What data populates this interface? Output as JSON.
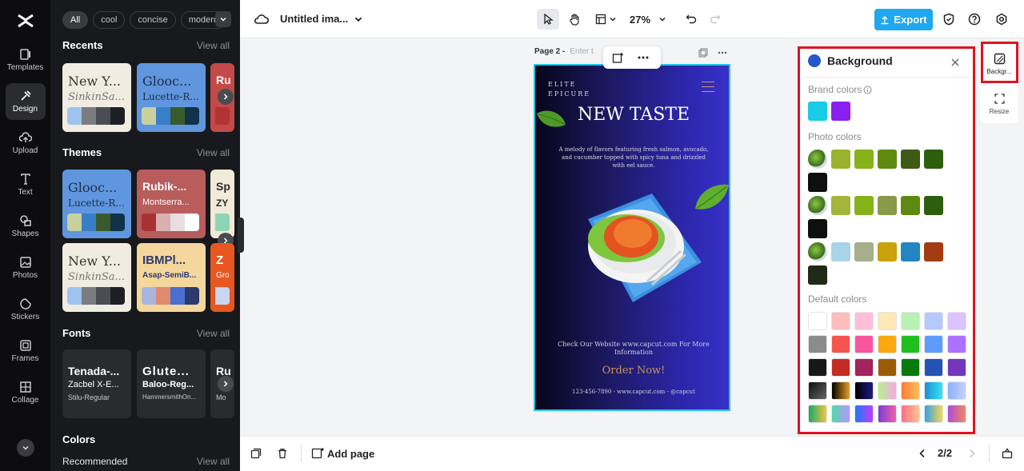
{
  "rail": {
    "items": [
      {
        "label": "Templates",
        "icon": "templates-icon"
      },
      {
        "label": "Design",
        "icon": "design-icon"
      },
      {
        "label": "Upload",
        "icon": "upload-icon"
      },
      {
        "label": "Text",
        "icon": "text-icon"
      },
      {
        "label": "Shapes",
        "icon": "shapes-icon"
      },
      {
        "label": "Photos",
        "icon": "photos-icon"
      },
      {
        "label": "Stickers",
        "icon": "stickers-icon"
      },
      {
        "label": "Frames",
        "icon": "frames-icon"
      },
      {
        "label": "Collage",
        "icon": "collage-icon"
      }
    ]
  },
  "panel": {
    "chips": [
      "All",
      "cool",
      "concise",
      "modern"
    ],
    "recents": {
      "title": "Recents",
      "link": "View all"
    },
    "themes": {
      "title": "Themes",
      "link": "View all"
    },
    "fonts": {
      "title": "Fonts",
      "link": "View all"
    },
    "colors": {
      "title": "Colors"
    },
    "recommended": {
      "title": "Recommended",
      "link": "View all"
    },
    "recent_cards": [
      {
        "t1": "New Y...",
        "t2": "SinkinSa..."
      },
      {
        "t1": "Glooc...",
        "t2": "Lucette-R..."
      },
      {
        "t1": "Ru",
        "t2": ""
      }
    ],
    "theme_cards": [
      {
        "t1": "Glooc...",
        "t2": "Lucette-R..."
      },
      {
        "t1": "Rubik-...",
        "t2": "Montserra..."
      },
      {
        "t1": "Sp",
        "t2": "ZY"
      },
      {
        "t1": "New Y...",
        "t2": "SinkinSa..."
      },
      {
        "t1": "IBMPl...",
        "t2": "Asap-SemiB..."
      },
      {
        "t1": "Z",
        "t2": "Gro"
      }
    ],
    "font_cards": [
      {
        "f1": "Tenada-...",
        "f2": "Zacbel X-E...",
        "f3": "Stilu-Regular"
      },
      {
        "f1": "Glute...",
        "f2": "Baloo-Reg...",
        "f3": "HammersmithOn..."
      },
      {
        "f1": "Ru",
        "f2": "",
        "f3": "Mo"
      }
    ]
  },
  "topbar": {
    "doc_title": "Untitled ima...",
    "zoom": "27%",
    "export_label": "Export"
  },
  "canvas": {
    "page_label": "Page 2 -",
    "page_title_placeholder": "Enter t",
    "brand": "ELITE EPICURE",
    "headline": "NEW TASTE",
    "body": "A melody of flavors featuring fresh salmon, avocado, and cucumber topped with spicy tuna and drizzled with eel sauce.",
    "website": "Check Our Website www.capcut.com For More Information",
    "cta": "Order Now!",
    "footer": "123-456-7890 - www.capcut.com - @capcut"
  },
  "bottombar": {
    "add_page": "Add page",
    "pager": "2/2"
  },
  "bg_panel": {
    "title": "Background",
    "brand_label": "Brand colors",
    "photo_label": "Photo colors",
    "default_label": "Default colors",
    "brand": [
      "#18cbe6",
      "#8a1ff2"
    ],
    "photo_rows": [
      [
        "#9bb22d",
        "#86b21a",
        "#5f8a12",
        "#3e5a14",
        "#2d5e0e",
        "#0f0f0f"
      ],
      [
        "#a3b53a",
        "#86b21a",
        "#8a9a4b",
        "#5f8a12",
        "#2d5e0e",
        "#0f0f0f"
      ],
      [
        "#a9d3e6",
        "#a6ae8b",
        "#c9a20c",
        "#2385c2",
        "#a33c12",
        "#1e2a16"
      ]
    ],
    "default_rows": [
      [
        "#ffffff",
        "#ffbcbc",
        "#ffbfd7",
        "#ffe7b8",
        "#b9f0b3",
        "#b6c9ff",
        "#dcc2ff"
      ],
      [
        "#8c8c8c",
        "#f4564e",
        "#f8559e",
        "#fca811",
        "#1fc01e",
        "#5e9bff",
        "#ad70ff"
      ],
      [
        "#181818",
        "#c32c22",
        "#a4225d",
        "#9a5d05",
        "#087a0b",
        "#2453b5",
        "#7535bd"
      ]
    ],
    "gradient_rows": [
      [
        "linear-gradient(135deg,#111 0%,#666 100%)",
        "linear-gradient(90deg,#000 0%,#e99e22 100%)",
        "linear-gradient(90deg,#000 0%,#1c1a88 100%)",
        "linear-gradient(90deg,#b6f28c 0%,#f7a6e8 100%)",
        "linear-gradient(90deg,#ff7b36 0%,#ffbe5a 100%)",
        "linear-gradient(90deg,#1a8fd6 0%,#38e4f2 100%)",
        "linear-gradient(90deg,#8ab2ff 0%,#c9d0ff 100%)"
      ],
      [
        "linear-gradient(90deg,#1aa86b 0%,#f2c63c 100%)",
        "linear-gradient(90deg,#53d9a8 0%,#b597ff 100%)",
        "linear-gradient(90deg,#1b7bff 0%,#c13cff 100%)",
        "linear-gradient(90deg,#7c3bd6 0%,#f05fa8 100%)",
        "linear-gradient(90deg,#ff6f8f 0%,#ffc38a 100%)",
        "linear-gradient(90deg,#33a3e8 0%,#f6d74b 100%)",
        "linear-gradient(90deg,#b04ad6 0%,#f08a5d 100%)"
      ]
    ]
  },
  "right_panel": {
    "background": "Backgr...",
    "resize": "Resize"
  }
}
